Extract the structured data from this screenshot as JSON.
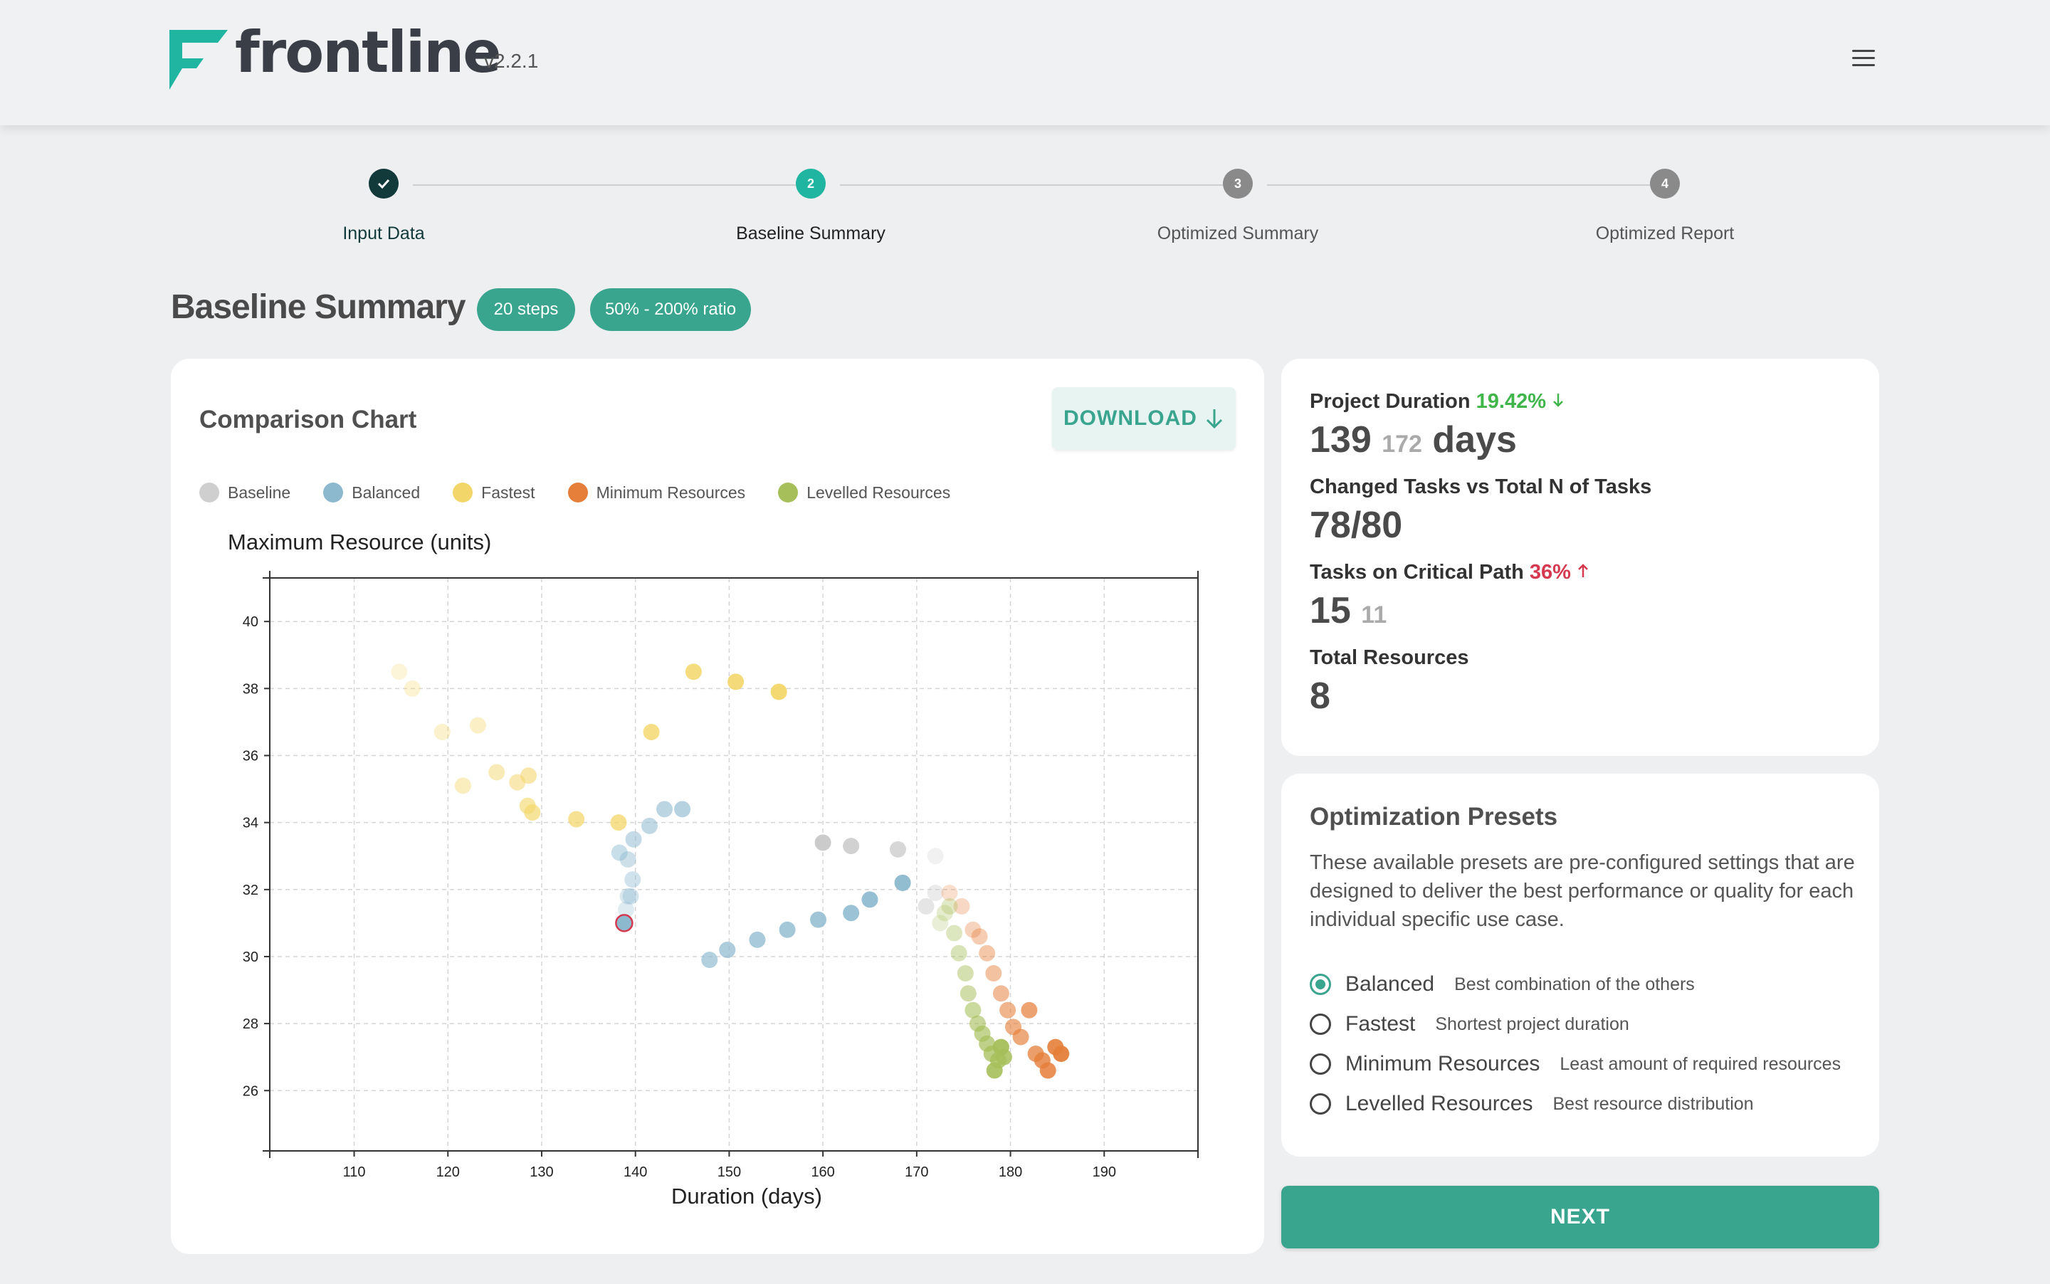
{
  "header": {
    "app_name": "frontline",
    "version": "v2.2.1",
    "menu_icon": "hamburger-menu-icon",
    "brand_color": "#1fb5a0"
  },
  "stepper": {
    "steps": [
      {
        "number": "✓",
        "label": "Input Data",
        "state": "done"
      },
      {
        "number": "2",
        "label": "Baseline Summary",
        "state": "active"
      },
      {
        "number": "3",
        "label": "Optimized Summary",
        "state": "pending"
      },
      {
        "number": "4",
        "label": "Optimized Report",
        "state": "pending"
      }
    ]
  },
  "page": {
    "title": "Baseline Summary",
    "badges": [
      "20 steps",
      "50% - 200% ratio"
    ]
  },
  "comparison": {
    "title": "Comparison Chart",
    "download_label": "DOWNLOAD",
    "download_icon": "arrow-down-icon"
  },
  "chart_data": {
    "type": "scatter",
    "title": "",
    "xlabel": "Duration (days)",
    "ylabel": "Maximum Resource (units)",
    "xlim": [
      101,
      200
    ],
    "ylim": [
      24.2,
      41.3
    ],
    "xticks": [
      110,
      120,
      130,
      140,
      150,
      160,
      170,
      180,
      190
    ],
    "yticks": [
      26,
      28,
      30,
      32,
      34,
      36,
      38,
      40
    ],
    "grid": true,
    "legend_position": "top-left",
    "series": [
      {
        "name": "Baseline",
        "color": "#c8c8c8",
        "points": [
          [
            172,
            33.0
          ],
          [
            172,
            31.9
          ],
          [
            171,
            31.5
          ],
          [
            168.5,
            32.2
          ],
          [
            168,
            33.2
          ],
          [
            163,
            33.3
          ],
          [
            160,
            33.4
          ]
        ]
      },
      {
        "name": "Balanced",
        "color": "#8db9cf",
        "points": [
          [
            138.8,
            31.0
          ],
          [
            139,
            31.4
          ],
          [
            139.2,
            31.8
          ],
          [
            139.5,
            31.8
          ],
          [
            139.7,
            32.3
          ],
          [
            139.2,
            32.9
          ],
          [
            138.3,
            33.1
          ],
          [
            139.8,
            33.5
          ],
          [
            141.5,
            33.9
          ],
          [
            143.1,
            34.4
          ],
          [
            145,
            34.4
          ],
          [
            147.9,
            29.9
          ],
          [
            149.8,
            30.2
          ],
          [
            153,
            30.5
          ],
          [
            156.2,
            30.8
          ],
          [
            159.5,
            31.1
          ],
          [
            163,
            31.3
          ],
          [
            165,
            31.7
          ],
          [
            168.5,
            32.2
          ]
        ]
      },
      {
        "name": "Fastest",
        "color": "#f3d66a",
        "points": [
          [
            114.8,
            38.5
          ],
          [
            116.2,
            38.0
          ],
          [
            119.4,
            36.7
          ],
          [
            123.2,
            36.9
          ],
          [
            121.6,
            35.1
          ],
          [
            125.2,
            35.5
          ],
          [
            127.4,
            35.2
          ],
          [
            128.6,
            35.4
          ],
          [
            128.5,
            34.5
          ],
          [
            129,
            34.3
          ],
          [
            133.7,
            34.1
          ],
          [
            138.2,
            34.0
          ],
          [
            141.7,
            36.7
          ],
          [
            146.2,
            38.5
          ],
          [
            150.7,
            38.2
          ],
          [
            155.3,
            37.9
          ]
        ]
      },
      {
        "name": "Minimum Resources",
        "color": "#e57f3a",
        "points": [
          [
            173.5,
            31.9
          ],
          [
            174.8,
            31.5
          ],
          [
            176,
            30.8
          ],
          [
            176.7,
            30.6
          ],
          [
            177.5,
            30.1
          ],
          [
            178.2,
            29.5
          ],
          [
            179,
            28.9
          ],
          [
            179.7,
            28.4
          ],
          [
            180.3,
            27.9
          ],
          [
            181.1,
            27.6
          ],
          [
            182,
            28.4
          ],
          [
            182.7,
            27.1
          ],
          [
            183.4,
            26.9
          ],
          [
            184,
            26.6
          ],
          [
            184.8,
            27.3
          ],
          [
            185.4,
            27.1
          ]
        ]
      },
      {
        "name": "Levelled Resources",
        "color": "#a6bf5a",
        "points": [
          [
            172.5,
            31.0
          ],
          [
            173,
            31.3
          ],
          [
            173.5,
            31.5
          ],
          [
            174,
            30.7
          ],
          [
            174.5,
            30.1
          ],
          [
            175.2,
            29.5
          ],
          [
            175.5,
            28.9
          ],
          [
            176,
            28.4
          ],
          [
            176.5,
            28.0
          ],
          [
            177,
            27.7
          ],
          [
            177.5,
            27.4
          ],
          [
            178,
            27.1
          ],
          [
            178.7,
            26.9
          ],
          [
            179.3,
            27.0
          ],
          [
            178.3,
            26.6
          ],
          [
            179.0,
            27.3
          ]
        ]
      }
    ],
    "highlight": {
      "series": "Balanced",
      "x": 138.8,
      "y": 31.0,
      "ring_color": "#d6394f"
    }
  },
  "stats": {
    "project_duration": {
      "label": "Project Duration",
      "delta": "19.42%",
      "delta_icon": "arrow-down-icon",
      "value": "139",
      "previous": "172",
      "unit": "days"
    },
    "changed_tasks": {
      "label": "Changed Tasks vs Total N of Tasks",
      "value": "78/80"
    },
    "critical_path": {
      "label": "Tasks on Critical Path",
      "delta": "36%",
      "delta_icon": "arrow-up-icon",
      "value": "15",
      "previous": "11"
    },
    "total_resources": {
      "label": "Total Resources",
      "value": "8"
    }
  },
  "presets": {
    "title": "Optimization Presets",
    "description": "These available presets are pre-configured settings that are designed to deliver the best performance or quality for each individual specific use case.",
    "options": [
      {
        "name": "Balanced",
        "desc": "Best combination of the others",
        "checked": true
      },
      {
        "name": "Fastest",
        "desc": "Shortest project duration",
        "checked": false
      },
      {
        "name": "Minimum Resources",
        "desc": "Least amount of required resources",
        "checked": false
      },
      {
        "name": "Levelled Resources",
        "desc": "Best resource distribution",
        "checked": false
      }
    ]
  },
  "next_label": "NEXT"
}
